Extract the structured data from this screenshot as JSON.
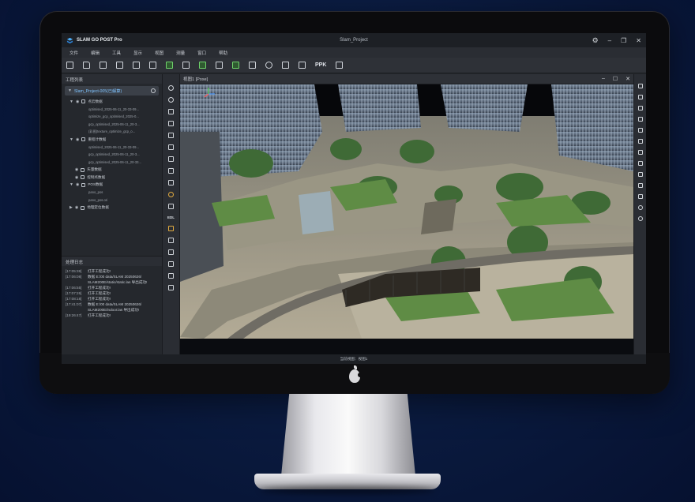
{
  "app": {
    "name": "SLAM GO POST Pro",
    "window_title": "Slam_Project"
  },
  "menu": [
    "文件",
    "编辑",
    "工具",
    "显示",
    "视图",
    "测量",
    "窗口",
    "帮助"
  ],
  "toolbar": {
    "icons": [
      "new-file-icon",
      "open-folder-icon",
      "import-icon",
      "save-icon",
      "export-icon",
      "layer-icon",
      "chart-icon",
      "axis-icon",
      "scan-icon",
      "check-icon",
      "car-icon",
      "walk-icon",
      "hand-icon",
      "camera-icon"
    ],
    "ppk_label": "PPK",
    "clipboard_icon": "clipboard-icon"
  },
  "project_panel": {
    "title": "工程列表",
    "project_name": "Slam_Project-005(已解算)",
    "tree": [
      {
        "level": 1,
        "label": "点云数据",
        "expanded": true
      },
      {
        "level": 2,
        "label": "optimised_2025-06-11_20-33-09..."
      },
      {
        "level": 2,
        "label": "optimize_gcp_optimised_2025-0..."
      },
      {
        "level": 2,
        "label": "gcp_optimised_2025-06-11_20-3..."
      },
      {
        "level": 2,
        "label": "(彩图)texture_optimize_gcp_o..."
      },
      {
        "level": 1,
        "label": "重程计数据",
        "expanded": true
      },
      {
        "level": 2,
        "label": "optimised_2025-06-11_20-33-09..."
      },
      {
        "level": 2,
        "label": "gcp_optimised_2025-06-11_20-3..."
      },
      {
        "level": 2,
        "label": "gcp_optimised_2025-06-11_20-33..."
      },
      {
        "level": 1,
        "label": "矢量数据"
      },
      {
        "level": 1,
        "label": "控制点数据"
      },
      {
        "level": 1,
        "label": "POS数据",
        "expanded": true
      },
      {
        "level": 2,
        "label": "pano_pos"
      },
      {
        "level": 2,
        "label": "pano_pos.ori"
      },
      {
        "level": 1,
        "label": "地理定位数据"
      }
    ]
  },
  "log_panel": {
    "title": "处理日志",
    "entries": [
      {
        "time": "[17:05:38]",
        "msg": "打开工程成功!"
      },
      {
        "time": "[17:06:08]",
        "msg": "数据 E:/00 data/SLAM 20250626/ SLAM200E/static/static.las 导出成功!"
      },
      {
        "time": "[17:06:55]",
        "msg": "打开工程成功!"
      },
      {
        "time": "[17:07:26]",
        "msg": "打开工程成功!"
      },
      {
        "time": "[17:08:18]",
        "msg": "打开工程成功!"
      },
      {
        "time": "[17:41:07]",
        "msg": "数据 E:/00 data/SLAM 20250626/ SLAM200E/indoor.las 导出成功!"
      },
      {
        "time": "[19:26:47]",
        "msg": "打开工程成功!"
      }
    ]
  },
  "viewport": {
    "title": "视图1 [Pose]"
  },
  "mid_tools": {
    "edl_label": "EDL"
  },
  "status": {
    "text": "当前视图：视图1"
  },
  "colors": {
    "accent": "#7fc3ff",
    "green": "#6fd36b",
    "panel_bg": "#25282d"
  }
}
